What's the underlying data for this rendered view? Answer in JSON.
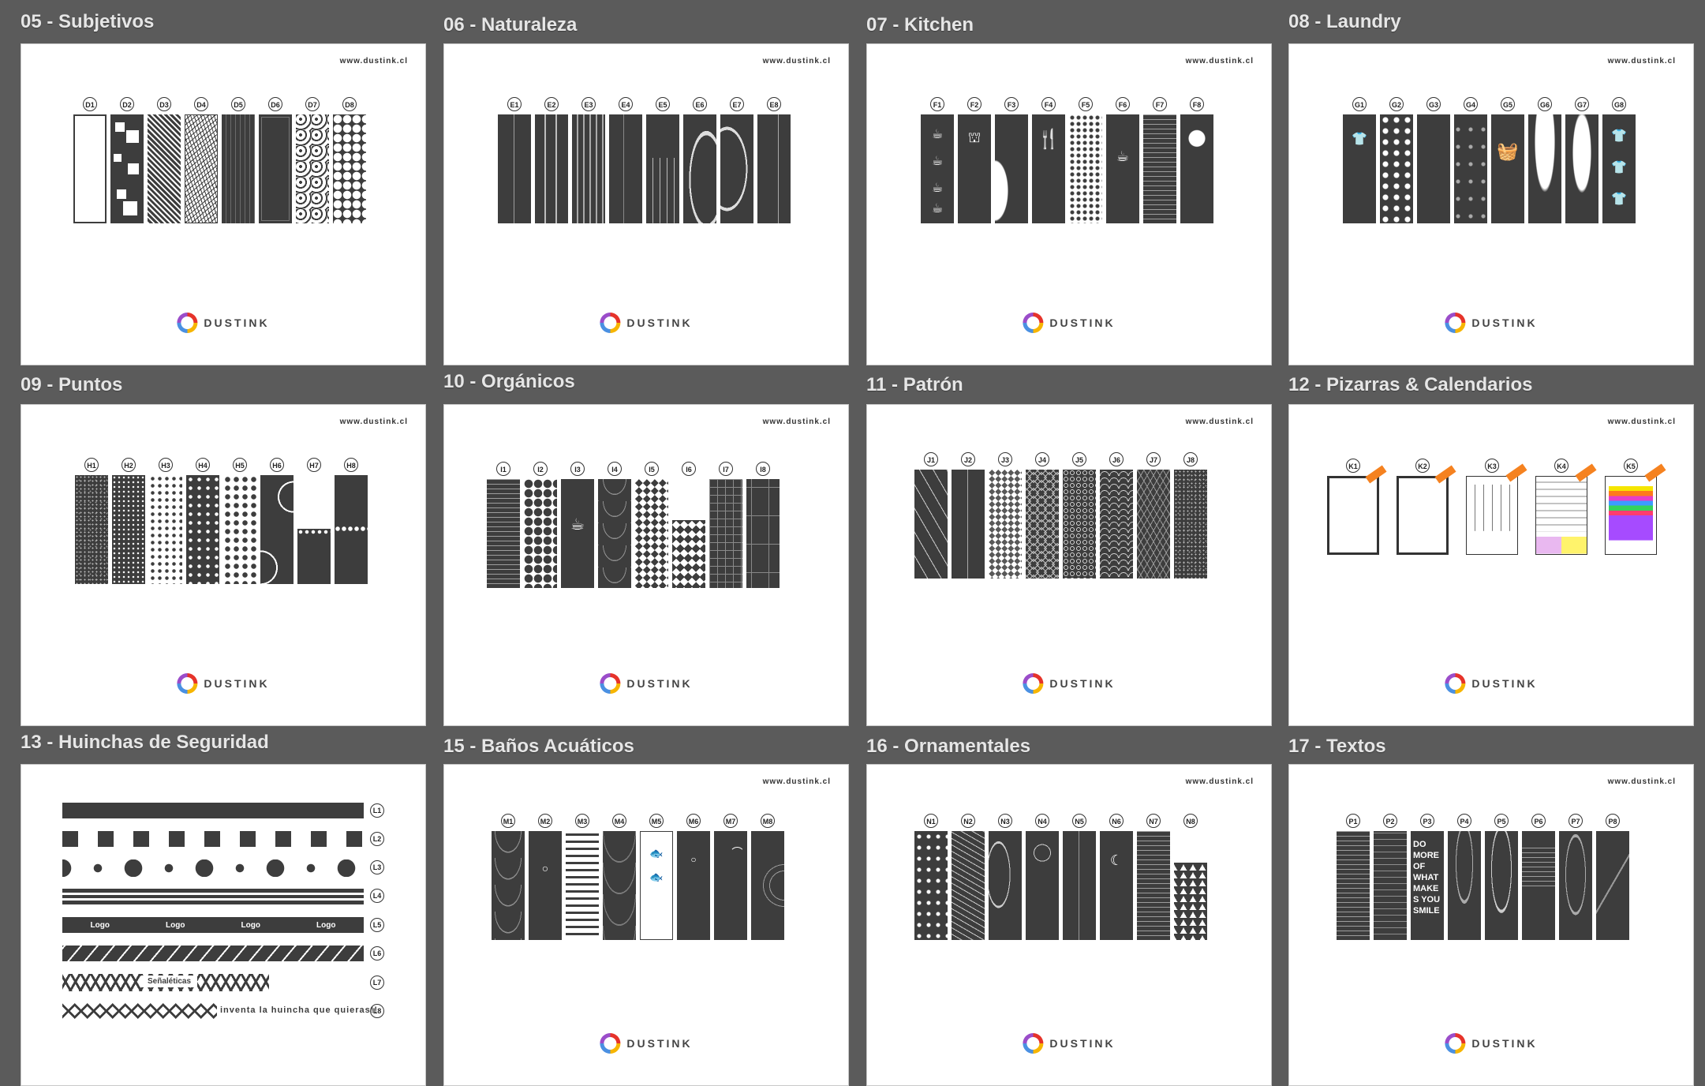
{
  "website": "www.dustink.cl",
  "brand": "DUSTINK",
  "colors": {
    "background": "#5b5b5b",
    "panel": "#3d3d3d",
    "tag": "#f58220"
  },
  "slides": [
    {
      "title": "05 - Subjetivos",
      "codes": [
        "D1",
        "D2",
        "D3",
        "D4",
        "D5",
        "D6",
        "D7",
        "D8"
      ]
    },
    {
      "title": "06 - Naturaleza",
      "codes": [
        "E1",
        "E2",
        "E3",
        "E4",
        "E5",
        "E6",
        "E7",
        "E8"
      ]
    },
    {
      "title": "07 - Kitchen",
      "codes": [
        "F1",
        "F2",
        "F3",
        "F4",
        "F5",
        "F6",
        "F7",
        "F8"
      ]
    },
    {
      "title": "08 - Laundry",
      "codes": [
        "G1",
        "G2",
        "G3",
        "G4",
        "G5",
        "G6",
        "G7",
        "G8"
      ]
    },
    {
      "title": "09 - Puntos",
      "codes": [
        "H1",
        "H2",
        "H3",
        "H4",
        "H5",
        "H6",
        "H7",
        "H8"
      ]
    },
    {
      "title": "10 - Orgánicos",
      "codes": [
        "I1",
        "I2",
        "I3",
        "I4",
        "I5",
        "I6",
        "I7",
        "I8"
      ]
    },
    {
      "title": "11 - Patrón",
      "codes": [
        "J1",
        "J2",
        "J3",
        "J4",
        "J5",
        "J6",
        "J7",
        "J8"
      ]
    },
    {
      "title": "12 - Pizarras & Calendarios",
      "codes": [
        "K1",
        "K2",
        "K3",
        "K4",
        "K5"
      ]
    },
    {
      "title": "13 - Huinchas de Seguridad",
      "codes": [
        "L1",
        "L2",
        "L3",
        "L4",
        "L5",
        "L6",
        "L7",
        "L8"
      ],
      "logo_label": "Logo",
      "signage_label": "Señaléticas",
      "invent_label": "inventa la huincha que quieras!!"
    },
    {
      "title": "15 - Baños Acuáticos",
      "codes": [
        "M1",
        "M2",
        "M3",
        "M4",
        "M5",
        "M6",
        "M7",
        "M8"
      ]
    },
    {
      "title": "16 - Ornamentales",
      "codes": [
        "N1",
        "N2",
        "N3",
        "N4",
        "N5",
        "N6",
        "N7",
        "N8"
      ]
    },
    {
      "title": "17 - Textos",
      "codes": [
        "P1",
        "P2",
        "P3",
        "P4",
        "P5",
        "P6",
        "P7",
        "P8"
      ],
      "smile_text": "DO MORE OF WHAT MAKES YOU SMILE"
    }
  ]
}
